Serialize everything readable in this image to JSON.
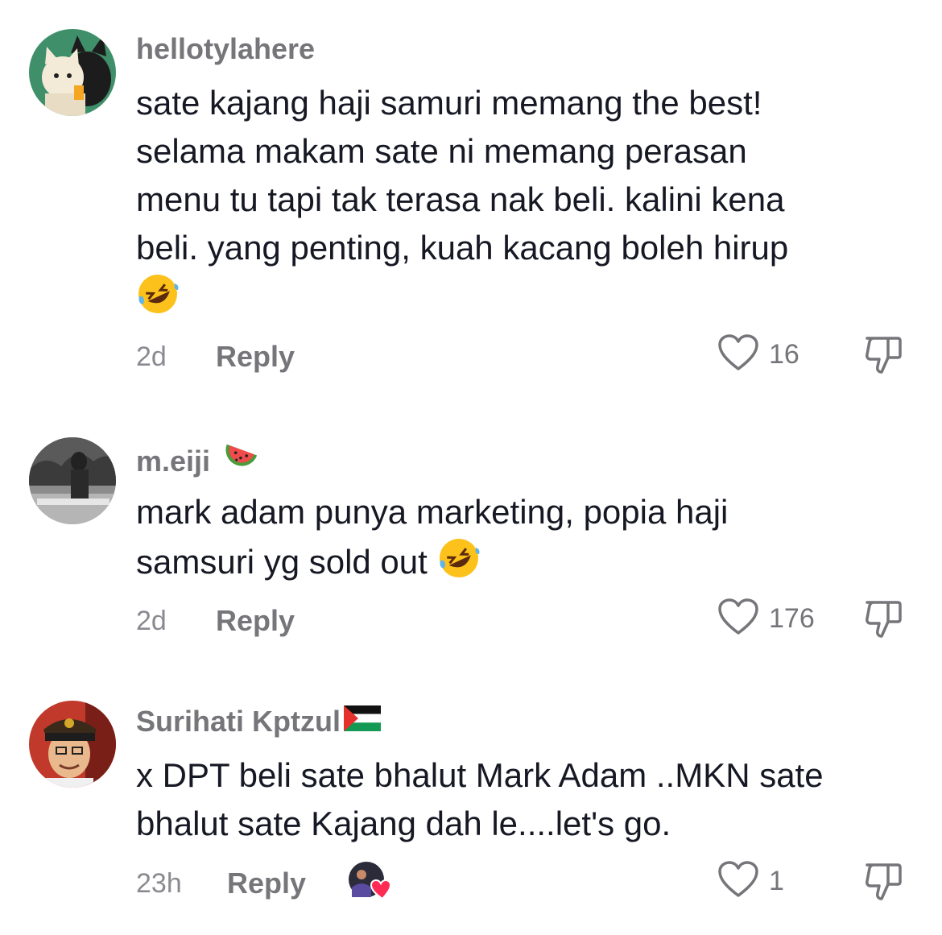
{
  "comments": [
    {
      "username": "hellotylahere",
      "username_suffix": "",
      "text": "sate kajang haji samuri memang the best!\nselama makam sate ni memang perasan\nmenu tu tapi tak terasa nak beli. kalini kena\nbeli. yang penting, kuah kacang boleh hirup",
      "time": "2d",
      "reply_label": "Reply",
      "likes": "16"
    },
    {
      "username": "m.eiji",
      "username_suffix": "watermelon-emoji",
      "text": "mark adam punya marketing, popia haji\nsamsuri yg sold out",
      "time": "2d",
      "reply_label": "Reply",
      "likes": "176"
    },
    {
      "username": "Surihati Kptzul",
      "username_suffix": "palestine-flag",
      "text": "x DPT beli sate bhalut Mark Adam ..MKN sate\nbhalut sate Kajang dah le....let's go.",
      "time": "23h",
      "reply_label": "Reply",
      "likes": "1"
    }
  ],
  "icons": {
    "like": "heart-outline-icon",
    "dislike": "thumbs-down-icon",
    "emoji": "rolling-on-floor-laughing-emoji",
    "creator_liked": "creator-liked-heart-avatar"
  },
  "colors": {
    "text": "#161823",
    "muted": "#75757a",
    "time": "#8a8b91",
    "heart_red": "#fe2c55"
  }
}
